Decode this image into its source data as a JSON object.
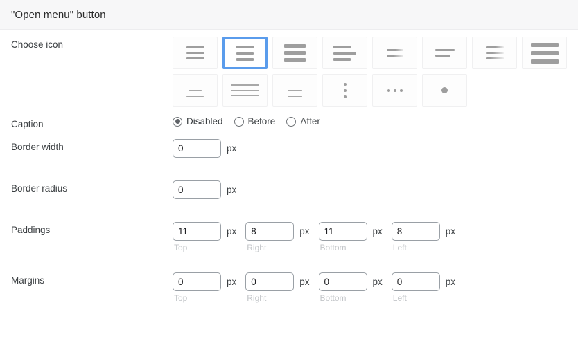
{
  "header": {
    "title": "\"Open menu\" button"
  },
  "fields": {
    "choose_icon": {
      "label": "Choose icon",
      "selected_index": 1,
      "icons": [
        {
          "name": "hamburger-3-line-short",
          "style": "three-thin"
        },
        {
          "name": "hamburger-3-line-medium",
          "style": "three-med"
        },
        {
          "name": "hamburger-3-line-thick",
          "style": "three-thick"
        },
        {
          "name": "hamburger-3-line-left-align",
          "style": "three-left"
        },
        {
          "name": "hamburger-3-line-mixed-width",
          "style": "three-mixed"
        },
        {
          "name": "hamburger-2-line-fade",
          "style": "two-fade"
        },
        {
          "name": "hamburger-3-line-fade",
          "style": "three-fade"
        },
        {
          "name": "hamburger-3-line-bold",
          "style": "three-bold"
        },
        {
          "name": "hamburger-3-line-hairline-short",
          "style": "hair-short"
        },
        {
          "name": "hamburger-3-line-hairline-wide",
          "style": "hair-wide"
        },
        {
          "name": "hamburger-3-line-hairline-medium",
          "style": "hair-med"
        },
        {
          "name": "kebab-vertical-dots",
          "style": "dots-vertical"
        },
        {
          "name": "meatball-horizontal-dots",
          "style": "dots-horizontal"
        },
        {
          "name": "single-dot",
          "style": "dot-single"
        }
      ]
    },
    "caption": {
      "label": "Caption",
      "selected": "Disabled",
      "options": [
        "Disabled",
        "Before",
        "After"
      ]
    },
    "border_width": {
      "label": "Border width",
      "value": "0",
      "unit": "px"
    },
    "border_radius": {
      "label": "Border radius",
      "value": "0",
      "unit": "px"
    },
    "paddings": {
      "label": "Paddings",
      "unit": "px",
      "sides": [
        {
          "sub_label": "Top",
          "value": "11"
        },
        {
          "sub_label": "Right",
          "value": "8"
        },
        {
          "sub_label": "Bottom",
          "value": "11"
        },
        {
          "sub_label": "Left",
          "value": "8"
        }
      ]
    },
    "margins": {
      "label": "Margins",
      "unit": "px",
      "sides": [
        {
          "sub_label": "Top",
          "value": "0"
        },
        {
          "sub_label": "Right",
          "value": "0"
        },
        {
          "sub_label": "Bottom",
          "value": "0"
        },
        {
          "sub_label": "Left",
          "value": "0"
        }
      ]
    }
  },
  "colors": {
    "selection_blue": "#5a9cec",
    "header_bg": "#f7f7f8",
    "glyph_gray": "#9e9e9e",
    "input_border": "#9aa0a6",
    "sub_label": "#c3c6c9"
  }
}
